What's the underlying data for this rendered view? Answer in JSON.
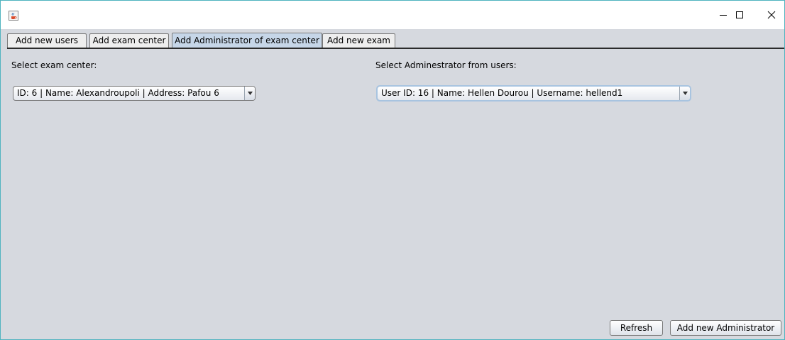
{
  "window": {
    "icon": "java-cup-icon",
    "controls": [
      "minimize-icon",
      "maximize-icon",
      "close-icon"
    ]
  },
  "tabs": [
    {
      "label": "Add new users",
      "active": false
    },
    {
      "label": "Add exam center",
      "active": false
    },
    {
      "label": "Add Administrator of exam center",
      "active": true
    },
    {
      "label": "Add new exam",
      "active": false
    }
  ],
  "form": {
    "exam_center_label": "Select exam center:",
    "exam_center_value": "ID: 6 | Name: Alexandroupoli | Address: Pafou 6",
    "admin_label": "Select Adminestrator from users:",
    "admin_value": "User ID: 16 | Name: Hellen Dourou | Username: hellend1"
  },
  "buttons": {
    "refresh": "Refresh",
    "add_admin": "Add new Administrator"
  },
  "colors": {
    "panel_bg": "#d6d9df",
    "active_tab": "#c6d6e8",
    "window_border": "#4fb3bf"
  }
}
